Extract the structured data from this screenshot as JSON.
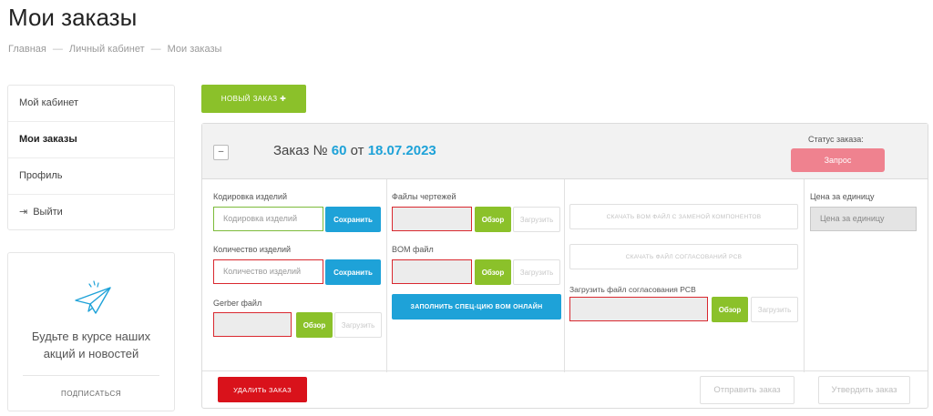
{
  "page": {
    "title": "Мои заказы"
  },
  "breadcrumb": [
    "Главная",
    "Личный кабинет",
    "Мои заказы"
  ],
  "sidebar": {
    "items": [
      {
        "label": "Мой кабинет"
      },
      {
        "label": "Мои заказы"
      },
      {
        "label": "Профиль"
      },
      {
        "label": "Выйти",
        "icon": "logout-icon"
      }
    ]
  },
  "subscribe": {
    "text": "Будьте в курсе наших акций и новостей",
    "link": "ПОДПИСАТЬСЯ",
    "icon": "paper-plane-icon"
  },
  "new_order": {
    "label": "НОВЫЙ ЗАКАЗ ✚"
  },
  "order": {
    "collapse_label": "–",
    "title_prefix": "Заказ №",
    "number": "60",
    "date_prefix": "от",
    "date": "18.07.2023",
    "status_label": "Статус заказа:",
    "status_value": "Запрос",
    "status_color": "#ef828f",
    "fields": {
      "marking_label": "Кодировка изделий",
      "marking_placeholder": "Кодировка изделий",
      "marking_save": "Сохранить",
      "qty_label": "Количество изделий",
      "qty_placeholder": "Количество изделий",
      "qty_save": "Сохранить",
      "gerber_label": "Gerber файл",
      "gerber_browse": "Обзор",
      "gerber_upload": "Загрузить",
      "drawings_label": "Файлы чертежей",
      "drawings_browse": "Обзор",
      "drawings_upload": "Загрузить",
      "bom_label": "BOM файл",
      "bom_browse": "Обзор",
      "bom_upload": "Загрузить",
      "bom_fill": "ЗАПОЛНИТЬ СПЕЦ-ЦИЮ BOM ОНЛАЙН",
      "download_bom": "СКАЧАТЬ BOM ФАЙЛ С ЗАМЕНОЙ КОМПОНЕНТОВ",
      "download_pcb": "СКАЧАТЬ ФАЙЛ СОГЛАСОВАНИЙ PCB",
      "upload_pcb_label": "Загрузить файл согласования PCB",
      "upload_pcb_browse": "Обзор",
      "upload_pcb_upload": "Загрузить",
      "price_label": "Цена за единицу",
      "price_placeholder": "Цена за единицу"
    },
    "actions": {
      "delete": "УДАЛИТЬ ЗАКАЗ",
      "send": "Отправить заказ",
      "confirm": "Утвердить заказ"
    }
  },
  "colors": {
    "accent_green": "#8bc12a",
    "accent_blue": "#1ea2d8",
    "danger_red": "#d9121b",
    "status_pink": "#ef828f"
  }
}
